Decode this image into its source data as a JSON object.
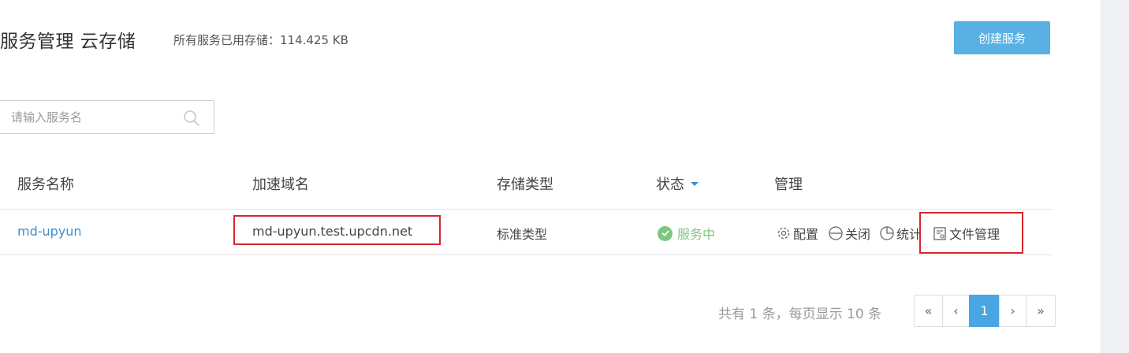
{
  "header": {
    "title": "服务管理 云存储",
    "usage_text": "所有服务已用存储：114.425 KB",
    "create_button": "创建服务"
  },
  "search": {
    "placeholder": "请输入服务名",
    "value": ""
  },
  "table": {
    "columns": [
      "服务名称",
      "加速域名",
      "存储类型",
      "状态",
      "管理"
    ],
    "rows": [
      {
        "service_name": "md-upyun",
        "domain": "md-upyun.test.upcdn.net",
        "storage_type": "标准类型",
        "status": "服务中",
        "actions": [
          "配置",
          "关闭",
          "统计",
          "文件管理"
        ]
      }
    ]
  },
  "pagination": {
    "info": "共有 1 条，每页显示 10 条",
    "first": "«",
    "prev": "‹",
    "current": "1",
    "next": "›",
    "last": "»"
  },
  "colors": {
    "accent": "#58b0e3",
    "link": "#3a8fd0",
    "status_ok": "#7cc77f",
    "highlight": "#d9262c"
  }
}
